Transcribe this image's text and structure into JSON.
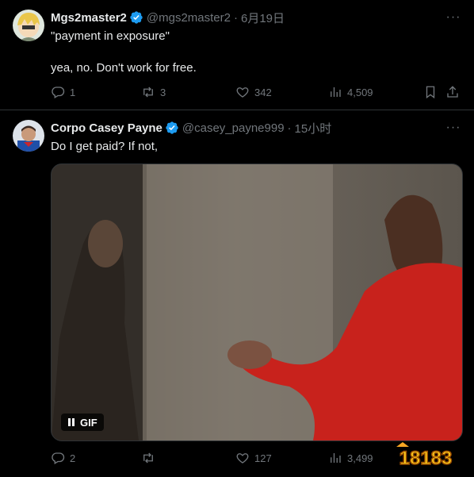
{
  "tweets": [
    {
      "name": "Mgs2master2",
      "handle": "@mgs2master2",
      "time": "6月19日",
      "text": "\"payment in exposure\"\n\nyea, no. Don't work for free.",
      "replies": "1",
      "reposts": "3",
      "likes": "342",
      "views": "4,509"
    },
    {
      "name": "Corpo Casey Payne",
      "handle": "@casey_payne999",
      "time": "15小时",
      "text": "Do I get paid? If not,",
      "gif_label": "GIF",
      "replies": "2",
      "reposts": "",
      "likes": "127",
      "views": "3,499"
    }
  ],
  "separator": "·",
  "watermark": "18183",
  "colors": {
    "background": "#000000",
    "text": "#e7e9ea",
    "secondary": "#71767b",
    "verified": "#1d9bf0",
    "border": "#2f3336"
  }
}
